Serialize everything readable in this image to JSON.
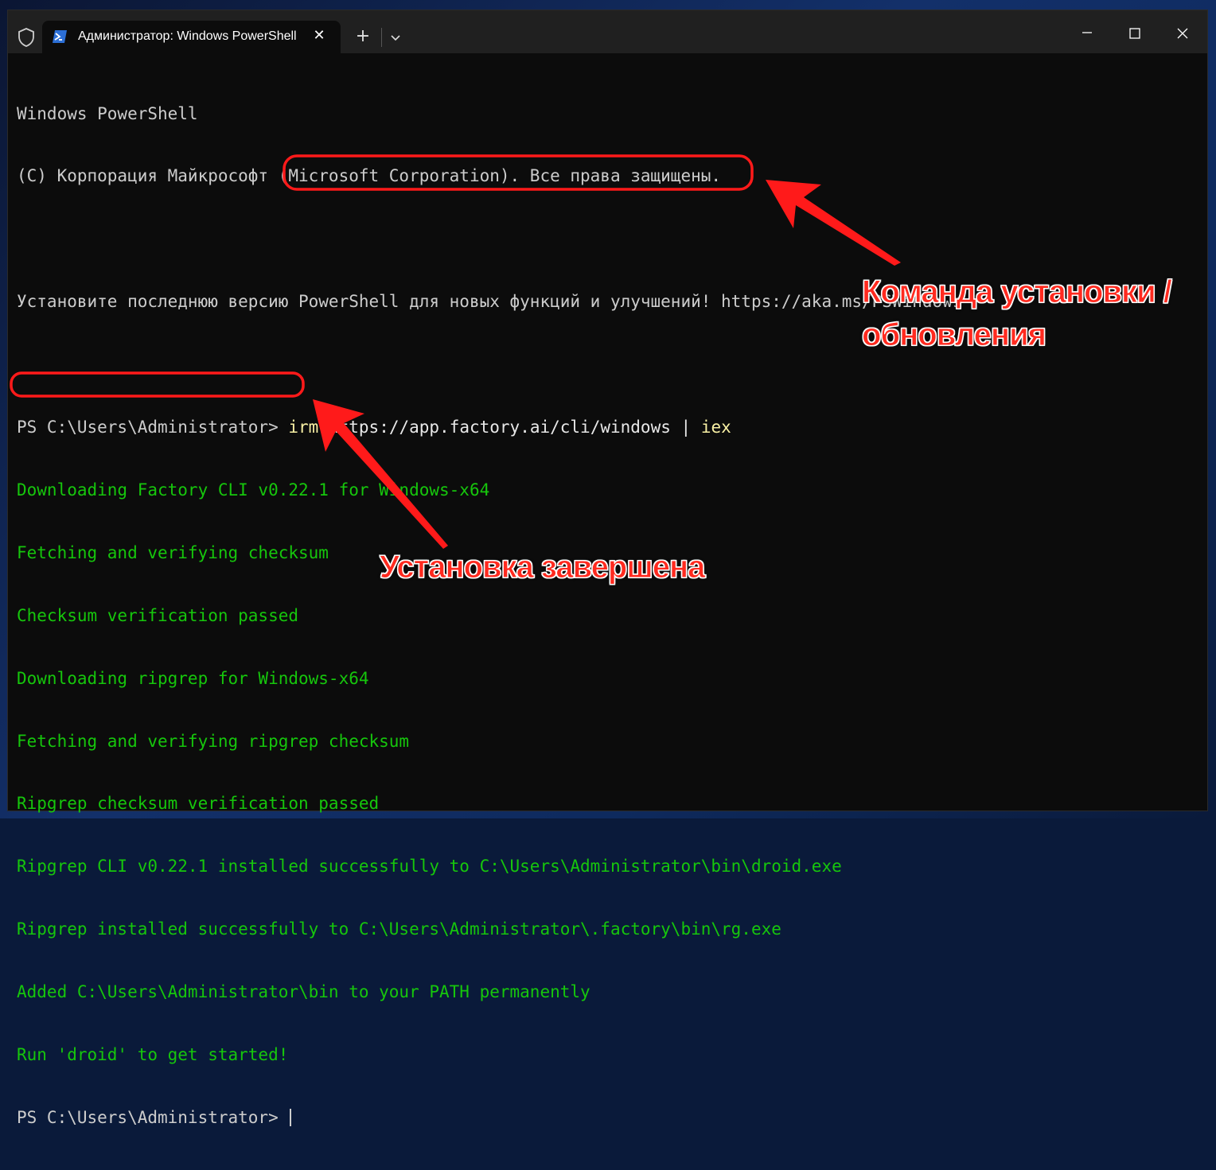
{
  "window": {
    "tab_title": "Администратор: Windows PowerShell",
    "tab_close_label": "✕",
    "new_tab_label": "+",
    "icons": {
      "shield": "shield-icon",
      "powershell": "powershell-icon",
      "dropdown": "chevron-down-icon",
      "minimize": "minimize-icon",
      "maximize": "maximize-icon",
      "close": "close-icon"
    }
  },
  "terminal": {
    "banner_1": "Windows PowerShell",
    "banner_2": "(C) Корпорация Майкрософт (Microsoft Corporation). Все права защищены.",
    "banner_3": "Установите последнюю версию PowerShell для новых функций и улучшений! https://aka.ms/PSWindows",
    "prompt": "PS C:\\Users\\Administrator>",
    "command_keyword": "irm",
    "command_url": "https://app.factory.ai/cli/windows",
    "command_pipe": "|",
    "command_iex": "iex",
    "output": [
      "Downloading Factory CLI v0.22.1 for Windows-x64",
      "Fetching and verifying checksum",
      "Checksum verification passed",
      "Downloading ripgrep for Windows-x64",
      "Fetching and verifying ripgrep checksum",
      "Ripgrep checksum verification passed",
      "Ripgrep CLI v0.22.1 installed successfully to C:\\Users\\Administrator\\bin\\droid.exe",
      "Ripgrep installed successfully to C:\\Users\\Administrator\\.factory\\bin\\rg.exe",
      "Added C:\\Users\\Administrator\\bin to your PATH permanently",
      "Run 'droid' to get started!"
    ],
    "final_prompt": "PS C:\\Users\\Administrator>"
  },
  "annotations": {
    "install_callout_line1": "Команда установки /",
    "install_callout_line2": "обновления",
    "done_callout": "Установка завершена",
    "color": "#ff2a1f"
  },
  "colors": {
    "terminal_bg": "#0c0c0c",
    "titlebar_bg": "#202020",
    "text_default": "#cccccc",
    "text_green": "#16c60c",
    "text_yellow": "#f9f1a5"
  }
}
